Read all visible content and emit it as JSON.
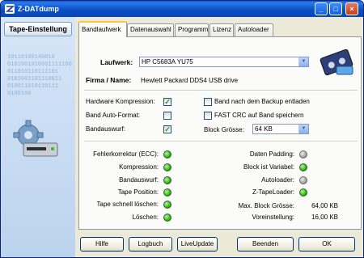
{
  "window": {
    "title": "Z-DATdump"
  },
  "sidebar": {
    "button_label": "Tape-Einstellung",
    "binary_text": "10110100140010\n0101001010001111100\n011010110111101\n0101001101110011\n010011010110111\n0100100"
  },
  "tabs": [
    {
      "label": "Bandlaufwerk",
      "active": true
    },
    {
      "label": "Datenauswahl",
      "active": false
    },
    {
      "label": "Programm",
      "active": false
    },
    {
      "label": "Lizenz",
      "active": false
    },
    {
      "label": "Autoloader",
      "active": false
    }
  ],
  "drive": {
    "label": "Laufwerk:",
    "value": "HP C5683A YU75",
    "company_label": "Firma / Name:",
    "company_value": "Hewlett Packard DDS4 USB drive"
  },
  "options": {
    "hw_compression": {
      "label": "Hardware Kompression:",
      "checked": true
    },
    "auto_format": {
      "label": "Band Auto-Format:",
      "checked": false
    },
    "eject": {
      "label": "Bandauswurf:",
      "checked": true
    },
    "unload_after_backup": {
      "label": "Band nach dem Backup entladen",
      "checked": false
    },
    "fast_crc": {
      "label": "FAST CRC auf Band speichern",
      "checked": false
    },
    "block_size": {
      "label": "Block Grösse:",
      "value": "64 KB"
    }
  },
  "status_left": [
    {
      "label": "Fehlerkorrektur (ECC):",
      "state": "green"
    },
    {
      "label": "Kompression:",
      "state": "green"
    },
    {
      "label": "Bandauswurf:",
      "state": "green"
    },
    {
      "label": "Tape Position:",
      "state": "green"
    },
    {
      "label": "Tape schnell löschen:",
      "state": "green"
    },
    {
      "label": "Löschen:",
      "state": "green"
    }
  ],
  "status_right": [
    {
      "label": "Daten Padding:",
      "state": "grey"
    },
    {
      "label": "Block ist Variabel:",
      "state": "green"
    },
    {
      "label": "Autoloader:",
      "state": "grey"
    },
    {
      "label": "Z-TapeLoader:",
      "state": "green"
    }
  ],
  "block_info": {
    "max_label": "Max. Block Grösse:",
    "max_value": "64,00 KB",
    "preset_label": "Voreinstellung:",
    "preset_value": "16,00 KB"
  },
  "buttons": {
    "help": "Hilfe",
    "logbook": "Logbuch",
    "liveupdate": "LiveUpdate",
    "exit": "Beenden",
    "ok": "OK"
  },
  "colors": {
    "led_green": "#3cb81c",
    "led_grey": "#a8a8a8",
    "title_blue": "#0a4fc4"
  }
}
